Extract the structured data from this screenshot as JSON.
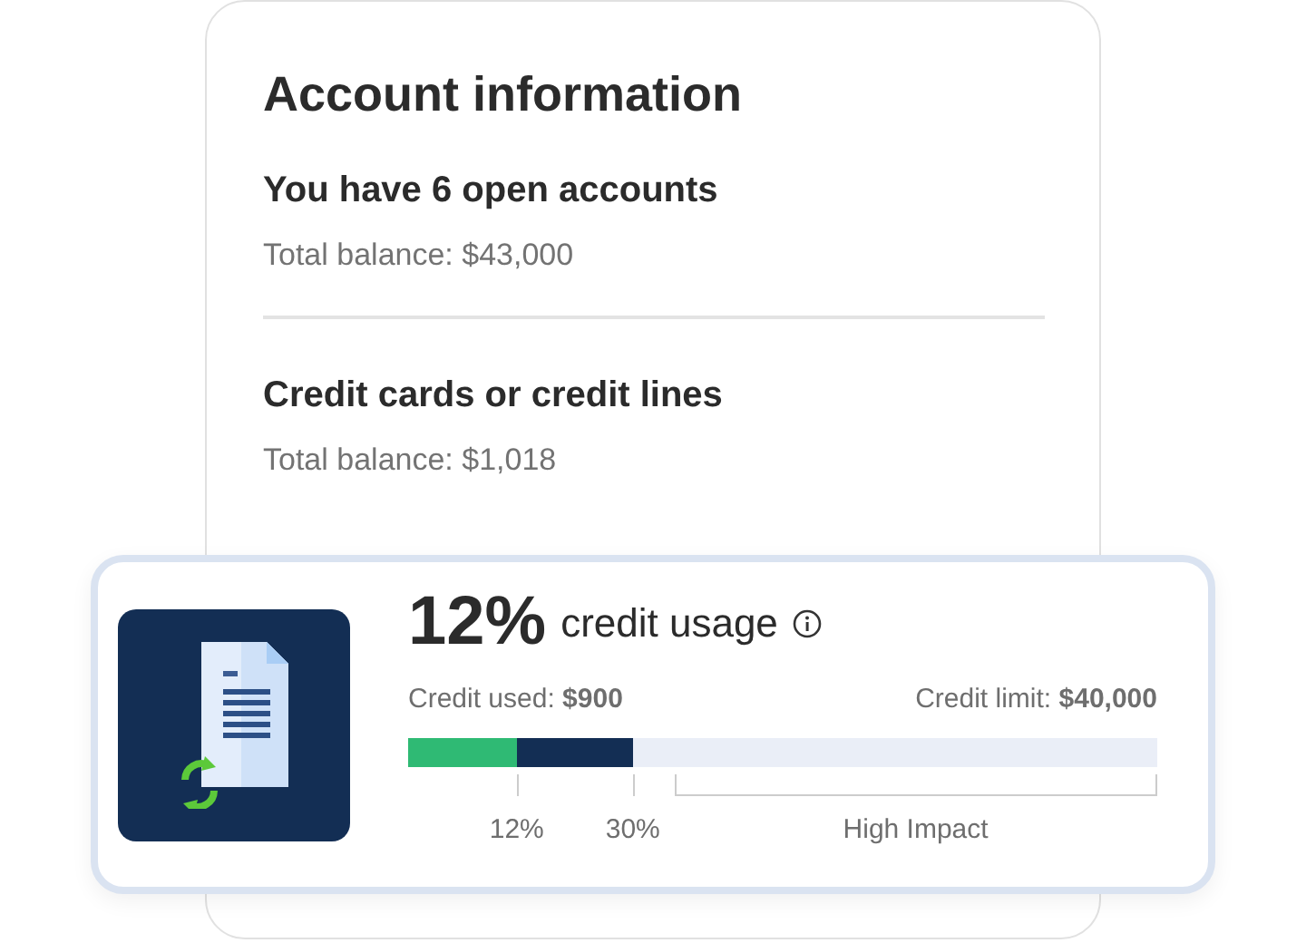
{
  "account_card": {
    "title": "Account information",
    "sections": [
      {
        "heading": "You have 6 open accounts",
        "balance": "Total balance: $43,000"
      },
      {
        "heading": "Credit cards or credit lines",
        "balance": "Total balance: $1,018"
      }
    ]
  },
  "usage_card": {
    "percent": "12%",
    "label": "credit usage",
    "used": "Credit used: **$900**",
    "limit": "Credit limit: **$40,000**",
    "segments": [
      {
        "level": 0.145,
        "color": "#2fba74"
      },
      {
        "level": 0.3,
        "color": "#132e54"
      }
    ],
    "ticks": [
      {
        "label": "12%"
      },
      {
        "label": "30%"
      }
    ],
    "zone": {
      "label": "High Impact"
    }
  }
}
